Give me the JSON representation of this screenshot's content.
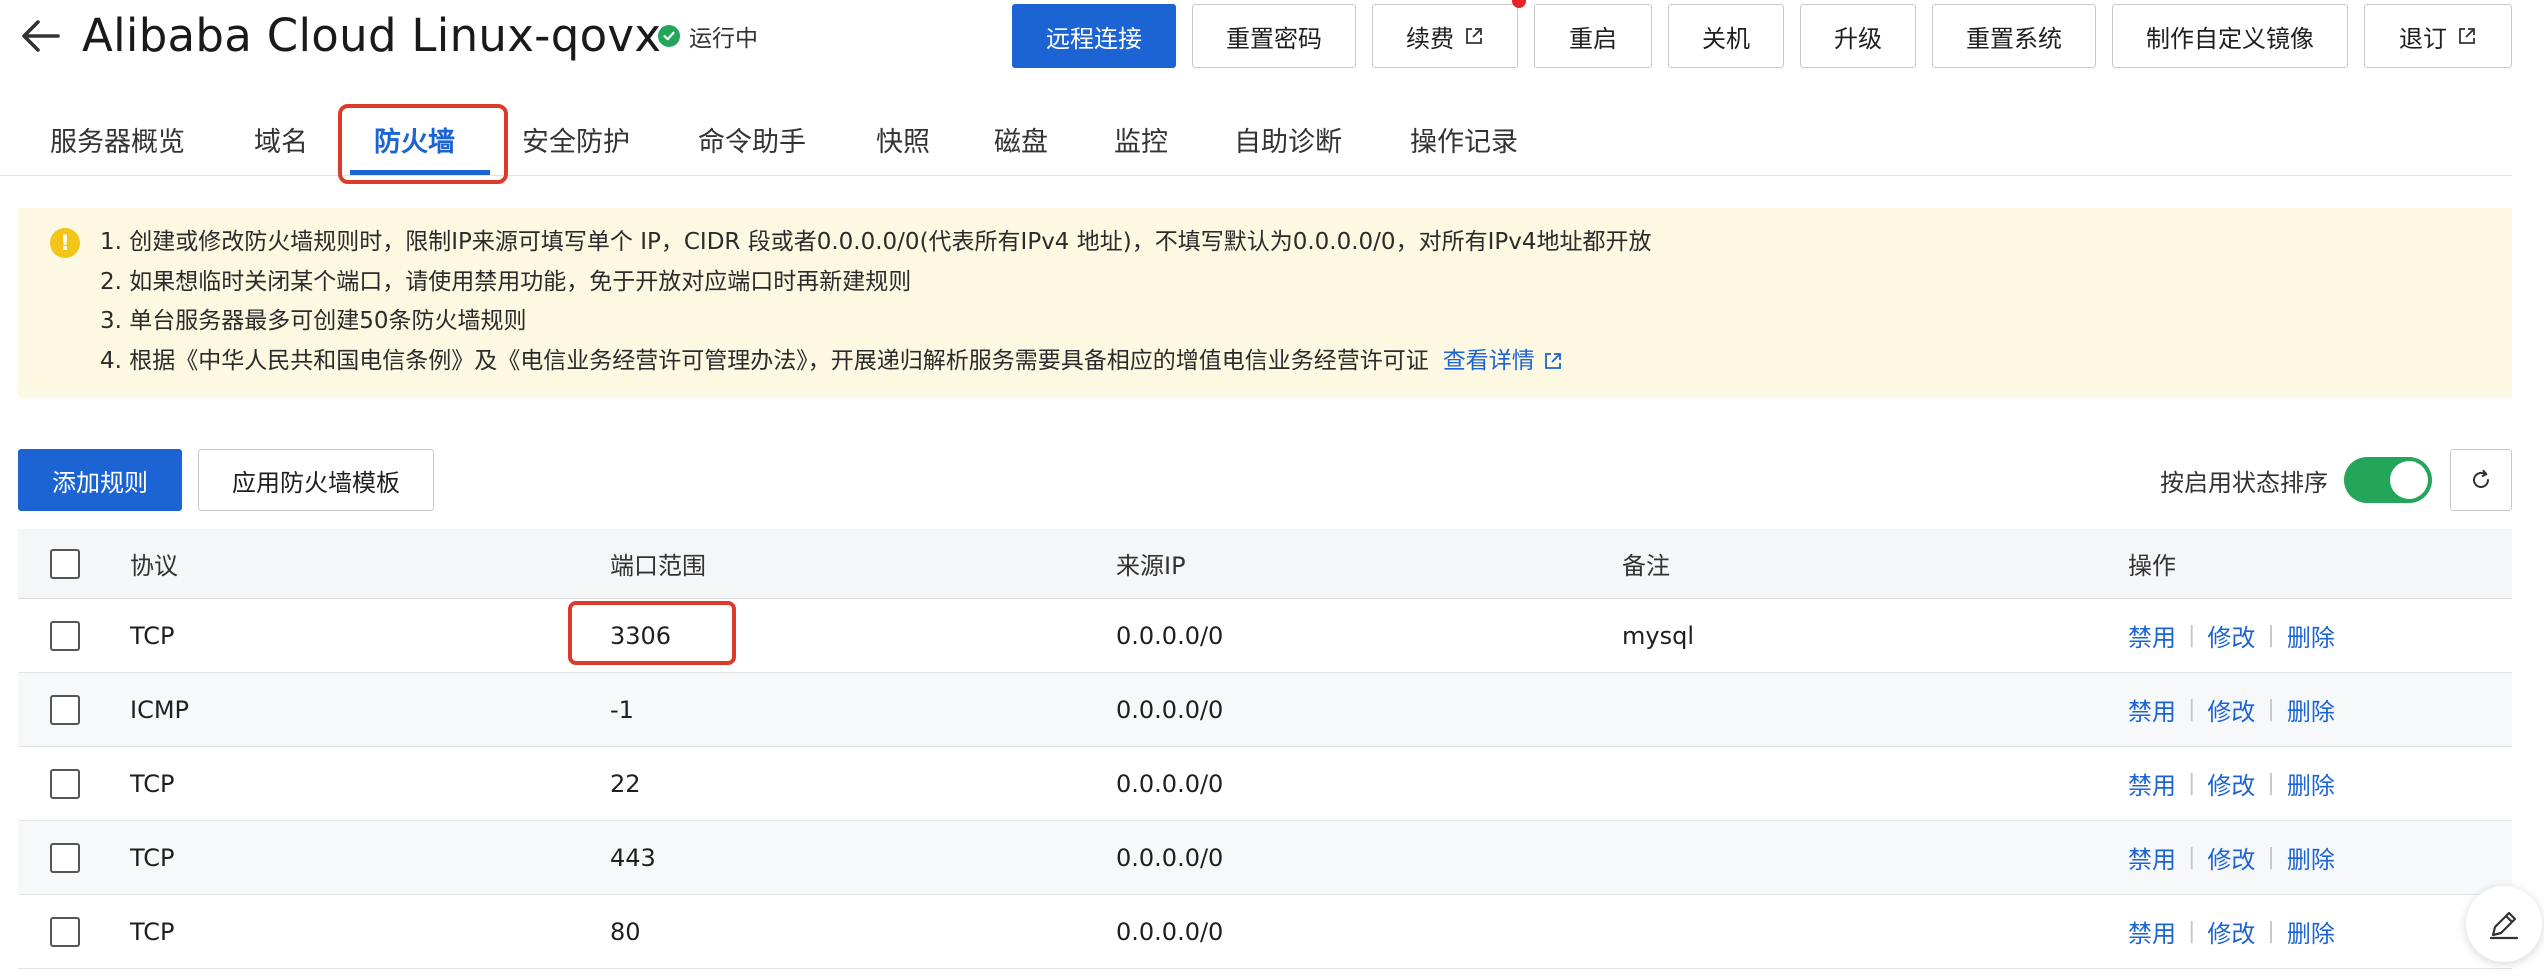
{
  "header": {
    "title": "Alibaba Cloud Linux-qovx",
    "status": "运行中",
    "buttons": {
      "remote": "远程连接",
      "reset_password": "重置密码",
      "renew": "续费",
      "restart": "重启",
      "shutdown": "关机",
      "upgrade": "升级",
      "reset_system": "重置系统",
      "custom_image": "制作自定义镜像",
      "unsubscribe": "退订"
    }
  },
  "tabs": {
    "overview": "服务器概览",
    "domain": "域名",
    "firewall": "防火墙",
    "security": "安全防护",
    "command": "命令助手",
    "snapshot": "快照",
    "disk": "磁盘",
    "monitor": "监控",
    "diagnosis": "自助诊断",
    "oplog": "操作记录",
    "active": "防火墙"
  },
  "notice": {
    "line1": "1. 创建或修改防火墙规则时，限制IP来源可填写单个 IP，CIDR 段或者0.0.0.0/0(代表所有IPv4 地址)，不填写默认为0.0.0.0/0，对所有IPv4地址都开放",
    "line2": "2. 如果想临时关闭某个端口，请使用禁用功能，免于开放对应端口时再新建规则",
    "line3": "3. 单台服务器最多可创建50条防火墙规则",
    "line4": "4. 根据《中华人民共和国电信条例》及《电信业务经营许可管理办法》，开展递归解析服务需要具备相应的增值电信业务经营许可证",
    "link": "查看详情"
  },
  "toolbar": {
    "add_rule": "添加规则",
    "apply_template": "应用防火墙模板",
    "sort_label": "按启用状态排序",
    "sort_enabled": true
  },
  "table": {
    "headers": {
      "protocol": "协议",
      "port": "端口范围",
      "source": "来源IP",
      "note": "备注",
      "ops": "操作"
    },
    "ops": {
      "disable": "禁用",
      "edit": "修改",
      "delete": "删除"
    },
    "rows": [
      {
        "protocol": "TCP",
        "port": "3306",
        "source": "0.0.0.0/0",
        "note": "mysql"
      },
      {
        "protocol": "ICMP",
        "port": "-1",
        "source": "0.0.0.0/0",
        "note": ""
      },
      {
        "protocol": "TCP",
        "port": "22",
        "source": "0.0.0.0/0",
        "note": ""
      },
      {
        "protocol": "TCP",
        "port": "443",
        "source": "0.0.0.0/0",
        "note": ""
      },
      {
        "protocol": "TCP",
        "port": "80",
        "source": "0.0.0.0/0",
        "note": ""
      }
    ]
  },
  "colors": {
    "primary": "#1c64d4",
    "running": "#23a55a",
    "highlight_red": "#dc3a2c",
    "notice_bg": "#fdf8e1"
  },
  "icons": [
    "back-arrow-icon",
    "check-icon",
    "external-link-icon",
    "warning-icon",
    "refresh-icon",
    "edit-pen-icon"
  ]
}
